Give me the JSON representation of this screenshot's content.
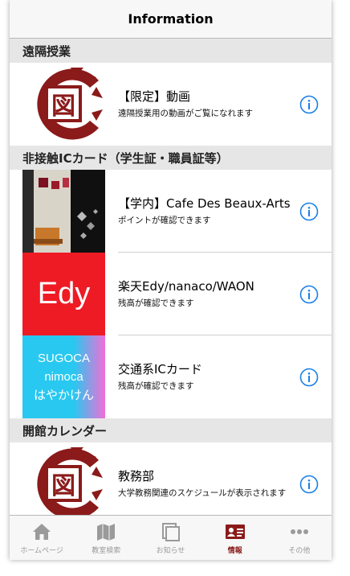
{
  "navbar": {
    "title": "Information"
  },
  "sections": [
    {
      "header": "遠隔授業"
    },
    {
      "header": "非接触ICカード（学生証・職員証等）"
    },
    {
      "header": "開館カレンダー"
    }
  ],
  "rows": {
    "remote": {
      "title": "【限定】動画",
      "sub": "遠隔授業用の動画がご覧になれます"
    },
    "cafe": {
      "title": "【学内】Cafe Des Beaux-Arts",
      "sub": "ポイントが確認できます"
    },
    "edy": {
      "title": "楽天Edy/nanaco/WAON",
      "sub": "残高が確認できます",
      "thumb_text": "Edy"
    },
    "ic": {
      "title": "交通系ICカード",
      "sub": "残高が確認できます",
      "thumb_lines": [
        "SUGOCA",
        "nimoca",
        "はやかけん"
      ]
    },
    "kyomu": {
      "title": "教務部",
      "sub": "大学教務関連のスケジュールが表示されます"
    }
  },
  "crest": {
    "text": "図"
  },
  "tabbar": {
    "tabs": [
      {
        "label": "ホームページ",
        "icon": "home-icon"
      },
      {
        "label": "教室検索",
        "icon": "map-icon"
      },
      {
        "label": "お知らせ",
        "icon": "notice-icon"
      },
      {
        "label": "情報",
        "icon": "id-card-icon"
      },
      {
        "label": "その他",
        "icon": "more-icon"
      }
    ]
  },
  "colors": {
    "accent": "#8b1a1a",
    "info": "#1a7fe8",
    "edy": "#ee1b24",
    "ic_cyan": "#28c8f0",
    "ic_pink": "#f06fd8"
  }
}
